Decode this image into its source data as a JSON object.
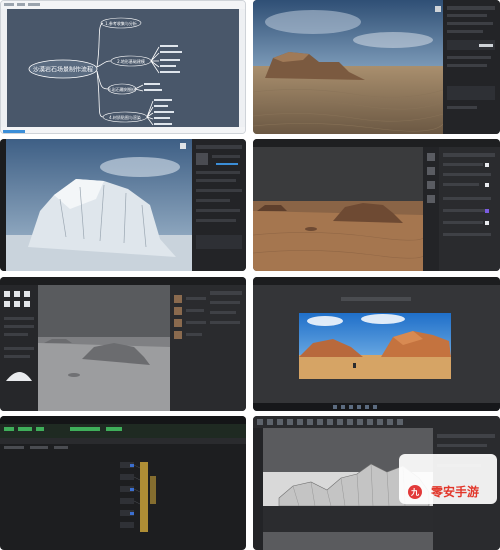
{
  "mindmap": {
    "center": "沙漠岩石场景制作流程",
    "branches": [
      {
        "label": "1.参考收集与分析"
      },
      {
        "label": "2.地形基础建模"
      },
      {
        "label": "3.岩石雕刻细化"
      },
      {
        "label": "4.材质贴图与渲染"
      }
    ],
    "colors": {
      "canvas": "#49576a",
      "line": "#ffffff",
      "node": "#5a6b80"
    }
  },
  "watermark": {
    "logo_char": "九",
    "text": "零安手游"
  },
  "panels": [
    {
      "name": "desert-mesa-render",
      "theme": "dark"
    },
    {
      "name": "snow-rock-sculpt",
      "theme": "dark"
    },
    {
      "name": "desert-rock-terrain",
      "theme": "dark"
    },
    {
      "name": "grey-rock-editor",
      "theme": "dark"
    },
    {
      "name": "canyon-composite-preview",
      "theme": "dark"
    },
    {
      "name": "node-graph-editor",
      "theme": "dark"
    },
    {
      "name": "wireframe-mountain-viewport",
      "theme": "dark"
    }
  ]
}
